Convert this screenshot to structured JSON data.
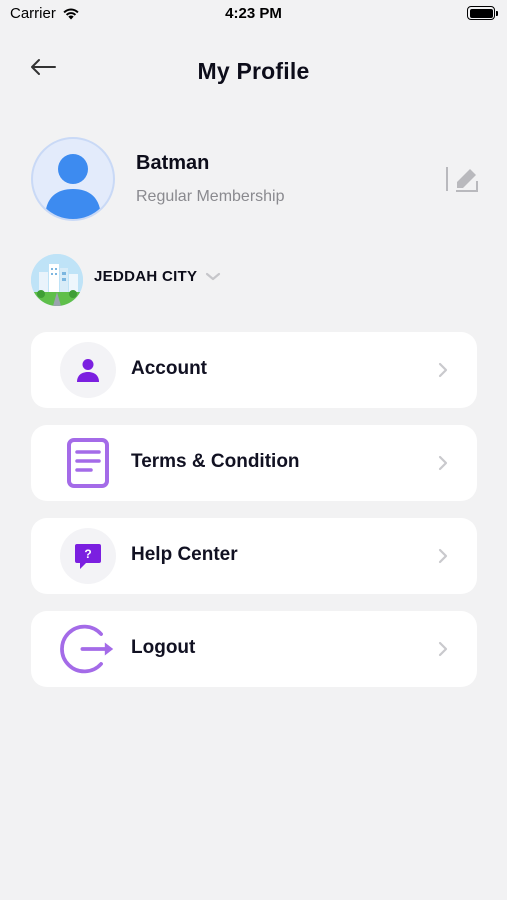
{
  "status_bar": {
    "carrier": "Carrier",
    "time": "4:23 PM"
  },
  "header": {
    "title": "My Profile"
  },
  "profile": {
    "name": "Batman",
    "membership": "Regular Membership"
  },
  "city": {
    "name": "JEDDAH CITY"
  },
  "menu": [
    {
      "label": "Account",
      "icon": "user-icon"
    },
    {
      "label": "Terms & Condition",
      "icon": "document-icon"
    },
    {
      "label": "Help Center",
      "icon": "help-chat-icon"
    },
    {
      "label": "Logout",
      "icon": "logout-icon"
    }
  ],
  "colors": {
    "accent": "#7b1fe0",
    "accent_light": "#a46be8",
    "background": "#f2f2f3",
    "avatar": "#3d8bf0"
  }
}
